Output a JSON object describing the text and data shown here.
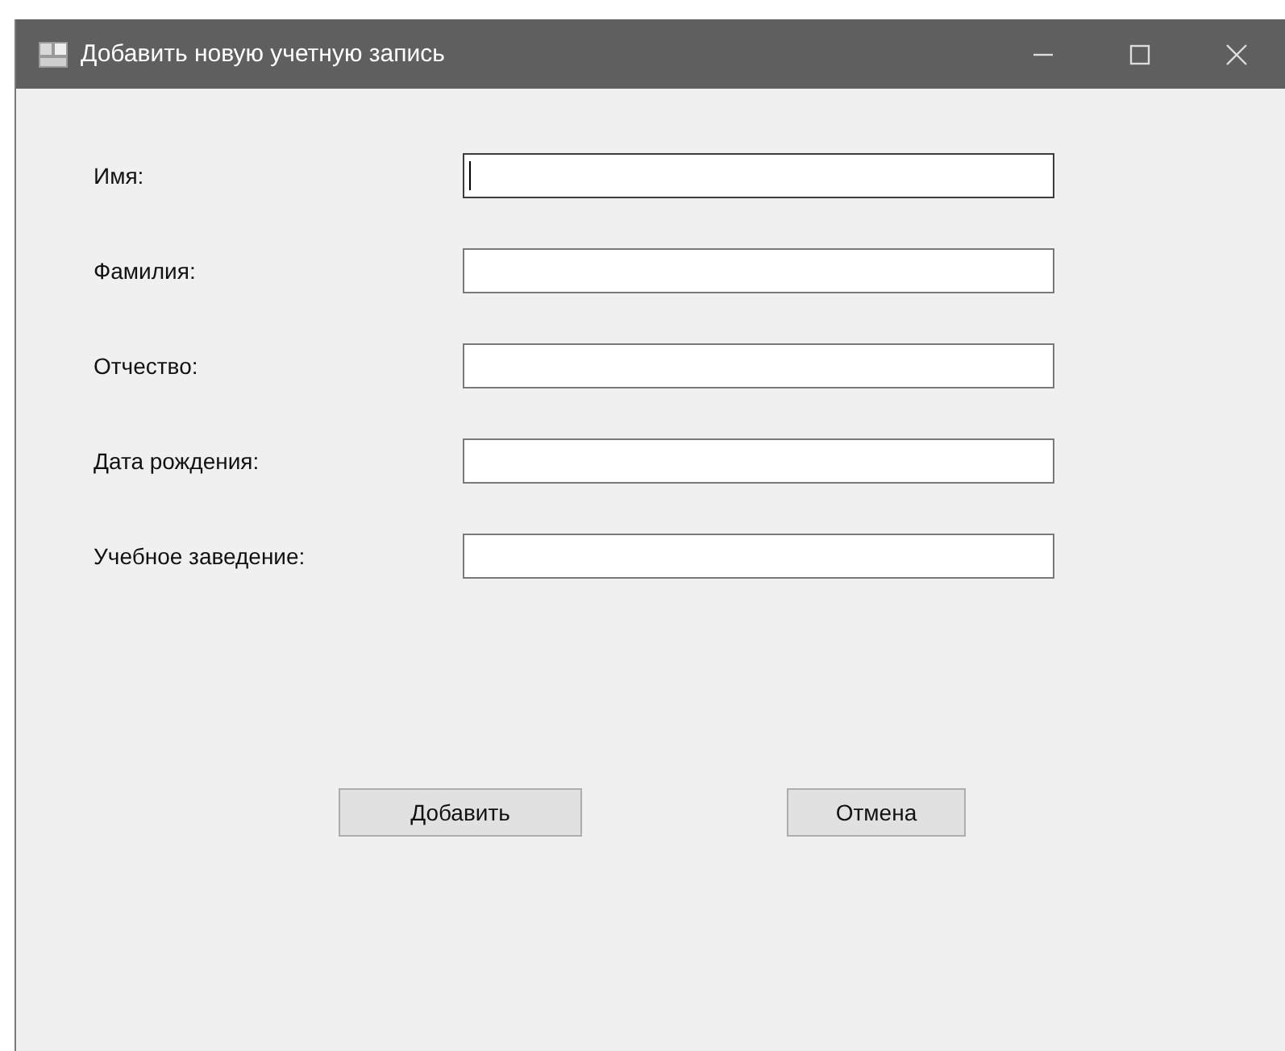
{
  "window": {
    "title": "Добавить новую учетную запись"
  },
  "fields": [
    {
      "label": "Имя:",
      "focused": true
    },
    {
      "label": "Фамилия:",
      "focused": false
    },
    {
      "label": "Отчество:",
      "focused": false
    },
    {
      "label": "Дата рождения:",
      "focused": false
    },
    {
      "label": "Учебное заведение:",
      "focused": false
    }
  ],
  "buttons": [
    {
      "label": "Добавить"
    },
    {
      "label": "Отмена"
    }
  ]
}
